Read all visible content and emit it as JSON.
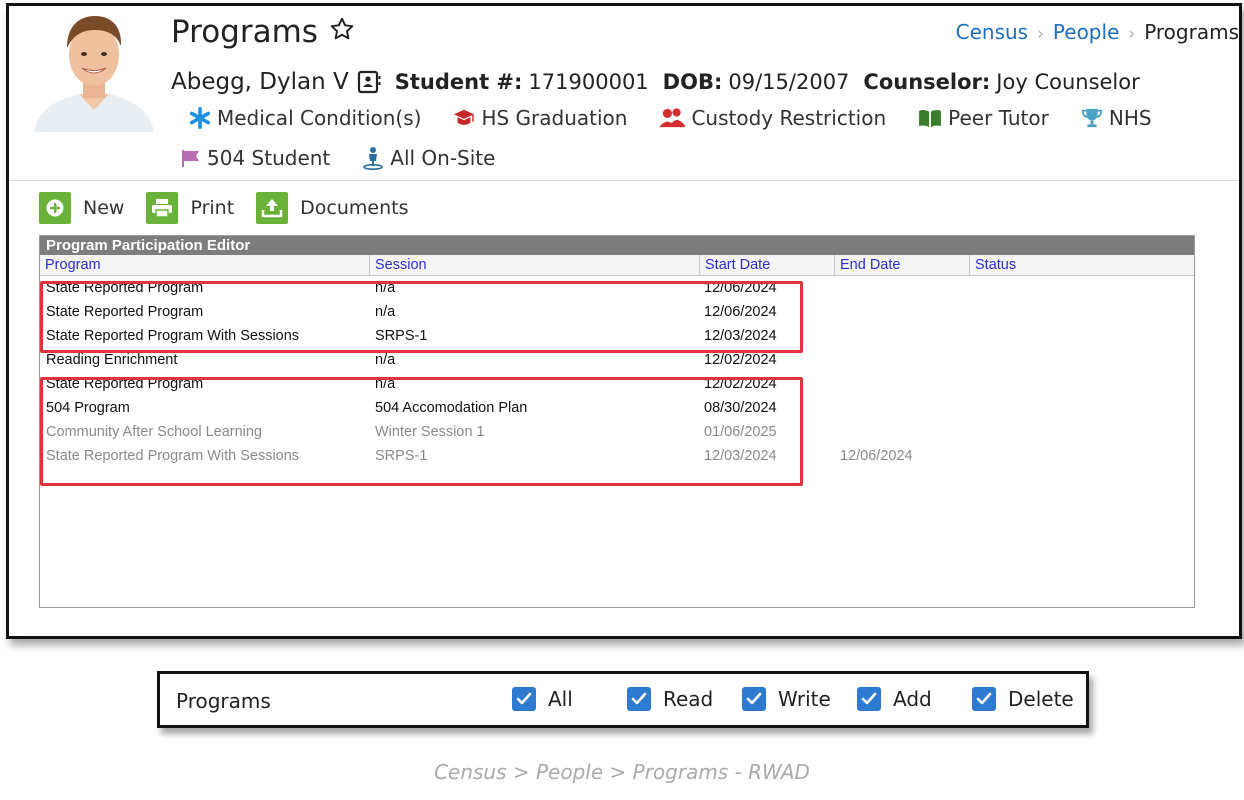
{
  "header": {
    "title": "Programs",
    "breadcrumb": [
      "Census",
      "People",
      "Programs"
    ]
  },
  "student": {
    "name": "Abegg, Dylan V",
    "student_num_label": "Student #:",
    "student_num": "171900001",
    "dob_label": "DOB:",
    "dob": "09/15/2007",
    "counselor_label": "Counselor:",
    "counselor": "Joy Counselor"
  },
  "flags": [
    {
      "label": "Medical Condition(s)",
      "icon": "asterisk-icon",
      "color": "#1e8fe0"
    },
    {
      "label": "HS Graduation",
      "icon": "graduation-cap-icon",
      "color": "#c62828"
    },
    {
      "label": "Custody Restriction",
      "icon": "users-icon",
      "color": "#d32f2f"
    },
    {
      "label": "Peer Tutor",
      "icon": "book-icon",
      "color": "#3a7d2c"
    },
    {
      "label": "NHS",
      "icon": "trophy-icon",
      "color": "#4aa3c4"
    },
    {
      "label": "504 Student",
      "icon": "flag-icon",
      "color": "#b96db3"
    },
    {
      "label": "All On-Site",
      "icon": "person-icon",
      "color": "#2b6f9f"
    }
  ],
  "toolbar": {
    "new_label": "New",
    "print_label": "Print",
    "documents_label": "Documents"
  },
  "grid": {
    "title": "Program Participation Editor",
    "columns": [
      "Program",
      "Session",
      "Start Date",
      "End Date",
      "Status"
    ],
    "rows": [
      {
        "program": "State Reported Program",
        "session": "n/a",
        "start": "12/06/2024",
        "end": "",
        "status": "",
        "inactive": false
      },
      {
        "program": "State Reported Program",
        "session": "n/a",
        "start": "12/06/2024",
        "end": "",
        "status": "",
        "inactive": false
      },
      {
        "program": "State Reported Program With Sessions",
        "session": "SRPS-1",
        "start": "12/03/2024",
        "end": "",
        "status": "",
        "inactive": false
      },
      {
        "program": "Reading Enrichment",
        "session": "n/a",
        "start": "12/02/2024",
        "end": "",
        "status": "",
        "inactive": false
      },
      {
        "program": "State Reported Program",
        "session": "n/a",
        "start": "12/02/2024",
        "end": "",
        "status": "",
        "inactive": false
      },
      {
        "program": "504 Program",
        "session": "504 Accomodation Plan",
        "start": "08/30/2024",
        "end": "",
        "status": "",
        "inactive": false
      },
      {
        "program": "Community After School Learning",
        "session": "Winter Session 1",
        "start": "01/06/2025",
        "end": "",
        "status": "",
        "inactive": true
      },
      {
        "program": "State Reported Program With Sessions",
        "session": "SRPS-1",
        "start": "12/03/2024",
        "end": "12/06/2024",
        "status": "",
        "inactive": true
      }
    ]
  },
  "permissions": {
    "label": "Programs",
    "options": [
      {
        "label": "All",
        "checked": true
      },
      {
        "label": "Read",
        "checked": true
      },
      {
        "label": "Write",
        "checked": true
      },
      {
        "label": "Add",
        "checked": true
      },
      {
        "label": "Delete",
        "checked": true
      }
    ]
  },
  "caption": "Census > People > Programs - RWAD",
  "colors": {
    "link": "#1d6fc1",
    "toolbar_green": "#6ab23a",
    "highlight_red": "#e0333d",
    "checkbox_blue": "#2f7ad1",
    "grid_header_text": "#2c2cd6"
  }
}
